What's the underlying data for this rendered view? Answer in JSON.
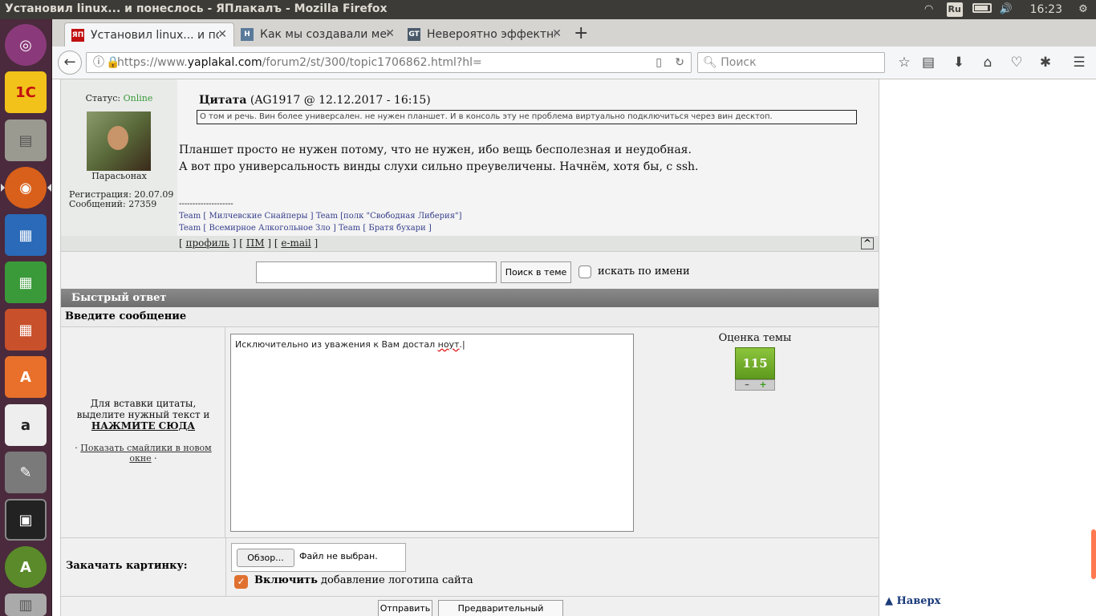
{
  "window_title": "Установил linux... и понеслось - ЯПлакалъ - Mozilla Firefox",
  "tray": {
    "keyboard_layout": "Ru",
    "clock": "16:23"
  },
  "tabs": [
    {
      "label": "Установил linux... и понеслось - ЯПлакалъ",
      "favicon": "ЯП"
    },
    {
      "label": "Как мы создавали мессенджер",
      "favicon": "H"
    },
    {
      "label": "Невероятно эффектный",
      "favicon": "GT"
    }
  ],
  "url": {
    "prefix": "https://www.",
    "domain": "yaplakal.com",
    "path": "/forum2/st/300/topic1706862.html?hl="
  },
  "search_placeholder": "Поиск",
  "post": {
    "status_label": "Статус:",
    "status_value": "Online",
    "nickname": "Парасьонах",
    "reg_line": "Регистрация: 20.07.09",
    "posts_line": "Сообщений: 27359",
    "quote_label": "Цитата",
    "quote_meta": "(AG1917 @ 12.12.2017 - 16:15)",
    "quote_text": "О том и речь. Вин более универсален. не нужен планшет. И в консоль эту не проблема виртуально подключиться через вин десктоп.",
    "text_line1": "Планшет просто не нужен потому, что не нужен, ибо вещь бесполезная и неудобная.",
    "text_line2": "А вот про универсальность винды слухи сильно преувеличены. Начнём, хотя бы, с ssh.",
    "sig_dash": "--------------------",
    "sig_line1": "Team [ Милчевские Снайперы ] Team [полк \"Свободная Либерия\"]",
    "sig_line2": "Team [ Всемирное Алкогольное Зло ] Team [ Братя бухари ]",
    "link_profile": "профиль",
    "link_pm": "ПМ",
    "link_email": "e-mail",
    "to_top": "^"
  },
  "search_in_topic": {
    "button": "Поиск в теме »",
    "checkbox_label": "искать по имени"
  },
  "quick_reply": {
    "header": "Быстрый ответ",
    "subheader": "Введите сообщение",
    "hint_line1": "Для вставки цитаты,",
    "hint_line2": "выделите нужный текст и",
    "hint_cta": "НАЖМИТЕ СЮДА",
    "smiles_link": "Показать смайлики в новом окне",
    "message_text": "Исключительно из уважения к Вам достал",
    "message_err_word": "ноут",
    "message_tail": ".",
    "rating_label": "Оценка темы",
    "rating_value": "115",
    "rating_minus": "–",
    "rating_plus": "+",
    "upload_label": "Закачать картинку:",
    "browse_button": "Обзор...",
    "no_file": "Файл не выбран.",
    "logo_bold": "Включить",
    "logo_rest": " добавление логотипа сайта",
    "submit": "Отправить",
    "preview": "Предварительный просмотр"
  },
  "naverh": "▲ Наверх",
  "colors": {
    "launcher": "#4a2a3c",
    "topbar": "#3c3b37",
    "online": "#3a9a3a",
    "rating": "#6aa82a",
    "link": "#333c8a"
  }
}
